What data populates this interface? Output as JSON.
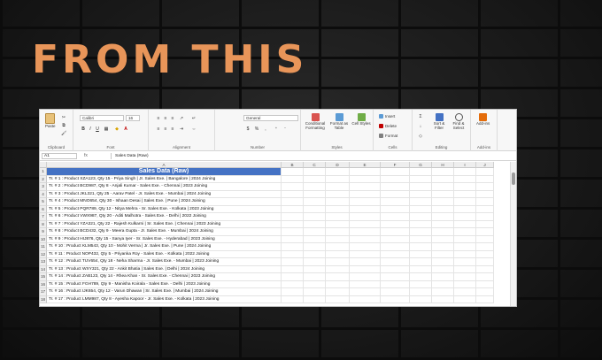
{
  "headline": "FROM THIS",
  "ribbon": {
    "clipboard": {
      "paste_label": "Paste",
      "group_label": "Clipboard"
    },
    "font": {
      "font_name": "Calibri",
      "font_size": "16",
      "group_label": "Font"
    },
    "alignment": {
      "group_label": "Alignment"
    },
    "number": {
      "format": "General",
      "group_label": "Number"
    },
    "styles": {
      "conditional": "Conditional Formatting",
      "format_table": "Format as Table",
      "cell_styles": "Cell Styles",
      "group_label": "Styles"
    },
    "cells": {
      "insert": "Insert",
      "delete": "Delete",
      "format": "Format",
      "group_label": "Cells"
    },
    "editing": {
      "sort": "Sort & Filter",
      "find": "Find & Select",
      "group_label": "Editing"
    },
    "addins": {
      "label": "Add-ins",
      "group_label": "Add-ins"
    }
  },
  "formula_bar": {
    "name_box": "A1",
    "fx": "fx",
    "value": "Sales Data (Raw)"
  },
  "columns": [
    "A",
    "B",
    "C",
    "D",
    "E",
    "F",
    "G",
    "H",
    "I",
    "J"
  ],
  "rows": [
    {
      "n": "1",
      "text": "Sales Data (Raw)"
    },
    {
      "n": "2",
      "text": "Tr. # 1 : Product XZA123, Qty 15 - Priya Singh | Jr. Sales Exe. | Bangalore | 2024 Joining"
    },
    {
      "n": "3",
      "text": "Tr. # 2 : Product BCD987, Qty 8 - Anjali Kumar - Sales Exe. - Chennai | 2023 Joining"
    },
    {
      "n": "4",
      "text": "Tr. # 3 : Product JKL321, Qty 25 - Aarav Patel - Jr. Sales Exe. - Mumbai | 2024 Joining"
    },
    {
      "n": "5",
      "text": "Tr. # 4 : Product MNO654, Qty 30 - Ishaan Desai | Sales Exe. | Pune | 2024 Joining"
    },
    {
      "n": "6",
      "text": "Tr. # 5 : Product PQR789, Qty 12 - Nitya Mehra - Sr. Sales Exe. - Kolkata | 2023 Joining"
    },
    {
      "n": "7",
      "text": "Tr. # 6 : Product VWX987, Qty 20 - Aditi Malhotra - Sales Exe. - Delhi | 2022 Joining"
    },
    {
      "n": "8",
      "text": "Tr. # 7 : Product YZA321, Qty 22 - Rajesh Kulkarni | Sr. Sales Exe. | Chennai | 2023 Joining"
    },
    {
      "n": "9",
      "text": "Tr. # 8 : Product BCD432, Qty 9 - Meera Gupta - Jr. Sales Exe. - Mumbai | 2024 Joining"
    },
    {
      "n": "10",
      "text": "Tr. # 9 : Product HIJ876, Qty 15 - Sanya Iyer - Sr. Sales Exe. - Hyderabad | 2023 Joining"
    },
    {
      "n": "11",
      "text": "Tr. # 10 : Product KLM543, Qty 10 - Mohit Verma | Jr. Sales Exe. | Pune | 2024 Joining"
    },
    {
      "n": "12",
      "text": "Tr. # 11 : Product NOP432, Qty 5 - Priyanka Roy - Sales Exe. - Kolkata | 2022 Joining"
    },
    {
      "n": "13",
      "text": "Tr. # 12 : Product TUV654, Qty 18 - Neha Sharma - Jr. Sales Exe. - Mumbai | 2023 Joining"
    },
    {
      "n": "14",
      "text": "Tr. # 13 : Product WXY321, Qty 22 - Ankit Bhatia | Sales Exe. | Delhi | 2024 Joining"
    },
    {
      "n": "15",
      "text": "Tr. # 14 : Product ZAB123, Qty 14 - Rhea Khan - Sr. Sales Exe. - Chennai | 2023 Joining"
    },
    {
      "n": "16",
      "text": "Tr. # 15 : Product FGH789, Qty 9 - Manisha Koirala - Sales Exe. - Delhi | 2023 Joining"
    },
    {
      "n": "17",
      "text": "Tr. # 16 : Product IJK654, Qty 12 - Varun Dhawan | Sr. Sales Exe. | Mumbai | 2024 Joining"
    },
    {
      "n": "18",
      "text": "Tr. # 17 : Product LMM987, Qty 8 - Ayesha Kapoor - Jr. Sales Exe. - Kolkata | 2023 Joining"
    }
  ]
}
